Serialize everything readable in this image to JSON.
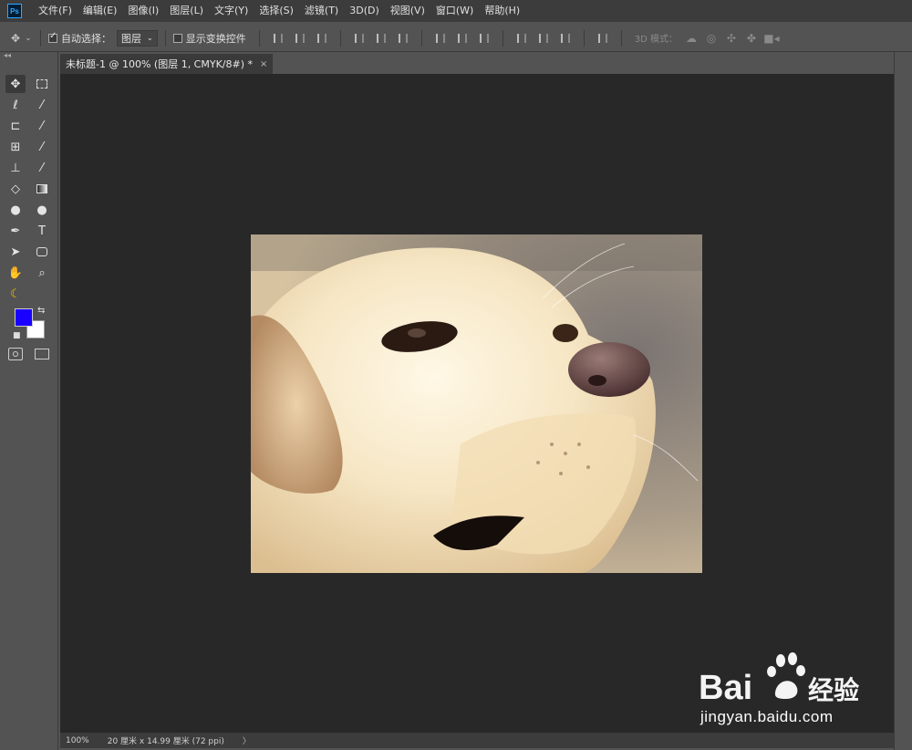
{
  "app": {
    "logo_text": "Ps"
  },
  "menu": [
    {
      "label": "文件(F)"
    },
    {
      "label": "编辑(E)"
    },
    {
      "label": "图像(I)"
    },
    {
      "label": "图层(L)"
    },
    {
      "label": "文字(Y)"
    },
    {
      "label": "选择(S)"
    },
    {
      "label": "滤镜(T)"
    },
    {
      "label": "3D(D)"
    },
    {
      "label": "视图(V)"
    },
    {
      "label": "窗口(W)"
    },
    {
      "label": "帮助(H)"
    }
  ],
  "options": {
    "auto_select_label": "自动选择：",
    "auto_select_checked": true,
    "auto_select_target": "图层",
    "show_transform_label": "显示变换控件",
    "show_transform_checked": false,
    "mode_3d_label": "3D 模式："
  },
  "document": {
    "tab_title": "未标题-1 @ 100% (图层 1, CMYK/8#) *",
    "close_icon": "×"
  },
  "status": {
    "zoom": "100%",
    "doc_size": "20 厘米 x 14.99 厘米 (72 ppi)",
    "arrow": "〉"
  },
  "colors": {
    "foreground": "#1a00ff",
    "background": "#ffffff"
  },
  "watermark": {
    "brand": "Bai  经验",
    "url": "jingyan.baidu.com"
  }
}
